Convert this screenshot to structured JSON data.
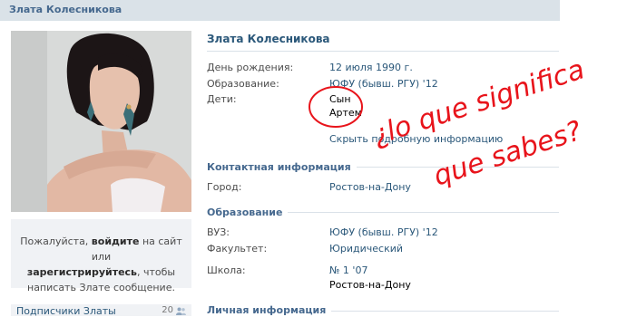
{
  "header": {
    "title": "Злата Колесникова"
  },
  "sidebar": {
    "login_prompt_1": "Пожалуйста, ",
    "login_link": "войдите",
    "login_prompt_2": " на сайт или",
    "register_link": "зарегистрируйтесь",
    "login_prompt_3": ", чтобы",
    "login_prompt_4": "написать Злате сообщение.",
    "subscribers_label": "Подписчики Златы",
    "subscribers_count": "20"
  },
  "profile": {
    "name": "Злата Колесникова",
    "birthday_label": "День рождения:",
    "birthday_value": "12 июля 1990 г.",
    "education_label": "Образование:",
    "education_value": "ЮФУ (бывш. РГУ) '12",
    "children_label": "Дети:",
    "child_relation": "Сын",
    "child_name": "Артем",
    "show_more": "Скрыть подробную информацию"
  },
  "contact": {
    "heading": "Контактная информация",
    "city_label": "Город:",
    "city_value": "Ростов-на-Дону"
  },
  "education": {
    "heading": "Образование",
    "university_label": "ВУЗ:",
    "university_value": "ЮФУ (бывш. РГУ) '12",
    "faculty_label": "Факультет:",
    "faculty_value": "Юридический",
    "school_label": "Школа:",
    "school_value": "№ 1 '07",
    "school_city": "Ростов-на-Дону"
  },
  "personal": {
    "heading": "Личная информация"
  },
  "annotation": {
    "line1": "¿lo que significa",
    "line2": "que sabes?",
    "color": "#e8141b"
  }
}
